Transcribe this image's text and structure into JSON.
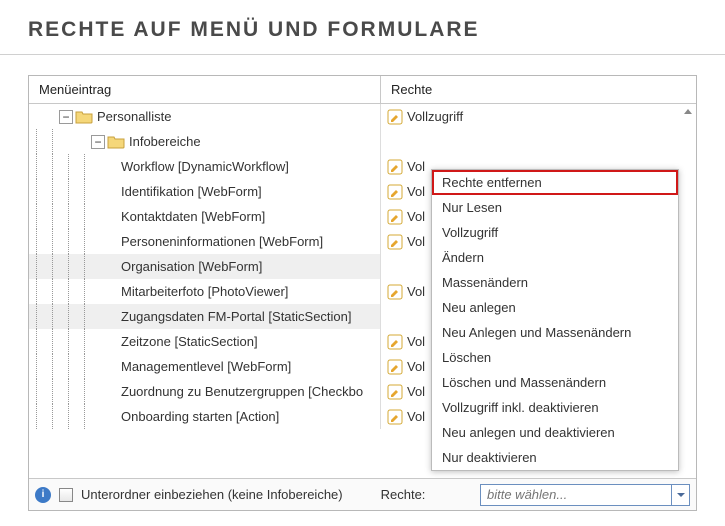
{
  "title": "RECHTE AUF MENÜ UND FORMULARE",
  "columns": {
    "menu": "Menüeintrag",
    "rights": "Rechte"
  },
  "footer": {
    "include_sub": "Unterordner einbeziehen (keine Infobereiche)",
    "rights_label": "Rechte:",
    "placeholder": "bitte wählen..."
  },
  "rights_label_full": "Vollzugriff",
  "rights_label_short": "Vol",
  "tree": {
    "root": {
      "label": "Personalliste"
    },
    "infobereich": {
      "label": "Infobereiche"
    },
    "items": [
      {
        "label": "Workflow [DynamicWorkflow]",
        "rights": "short",
        "selected": false
      },
      {
        "label": "Identifikation [WebForm]",
        "rights": "short",
        "selected": false
      },
      {
        "label": "Kontaktdaten [WebForm]",
        "rights": "short",
        "selected": false
      },
      {
        "label": "Personeninformationen [WebForm]",
        "rights": "short",
        "selected": false
      },
      {
        "label": "Organisation [WebForm]",
        "rights": "none",
        "selected": true
      },
      {
        "label": "Mitarbeiterfoto [PhotoViewer]",
        "rights": "short",
        "selected": false
      },
      {
        "label": "Zugangsdaten FM-Portal [StaticSection]",
        "rights": "none",
        "selected": true
      },
      {
        "label": "Zeitzone [StaticSection]",
        "rights": "short",
        "selected": false
      },
      {
        "label": "Managementlevel [WebForm]",
        "rights": "short",
        "selected": false
      },
      {
        "label": "Zuordnung zu Benutzergruppen [Checkbo",
        "rights": "short",
        "selected": false
      },
      {
        "label": "Onboarding starten [Action]",
        "rights": "short",
        "selected": false
      }
    ]
  },
  "menu": [
    "Rechte entfernen",
    "Nur Lesen",
    "Vollzugriff",
    "Ändern",
    "Massenändern",
    "Neu anlegen",
    "Neu Anlegen und Massenändern",
    "Löschen",
    "Löschen und Massenändern",
    "Vollzugriff inkl. deaktivieren",
    "Neu anlegen und deaktivieren",
    "Nur deaktivieren"
  ]
}
